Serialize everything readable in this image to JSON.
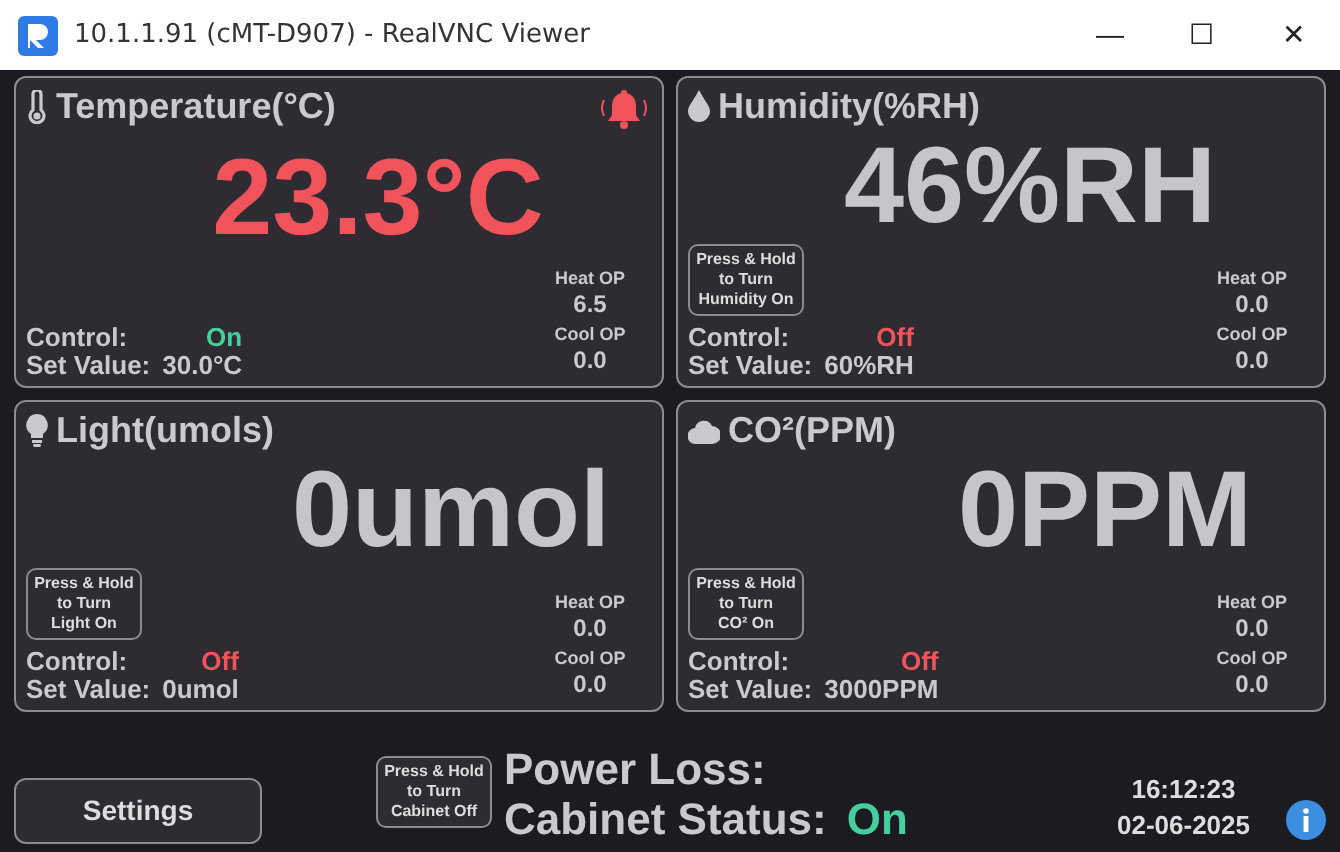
{
  "window": {
    "title": "10.1.1.91 (cMT-D907) - RealVNC Viewer",
    "controls": [
      "—",
      "☐",
      "✕"
    ]
  },
  "panels": [
    {
      "kind": "temperature",
      "title": "Temperature(°C)",
      "alarm": true,
      "reading": "23.3°C",
      "reading_alarm": true,
      "control_label": "Control:",
      "control_value": "On",
      "control_on": true,
      "set_label": "Set Value:",
      "set_value": "30.0°C",
      "heat_label": "Heat OP",
      "heat_value": "6.5",
      "cool_label": "Cool OP",
      "cool_value": "0.0"
    },
    {
      "kind": "humidity",
      "title": "Humidity(%RH)",
      "alarm": false,
      "reading": "46%RH",
      "reading_alarm": false,
      "button": [
        "Press & Hold",
        "to Turn",
        "Humidity On"
      ],
      "control_label": "Control:",
      "control_value": "Off",
      "control_on": false,
      "set_label": "Set Value:",
      "set_value": "60%RH",
      "heat_label": "Heat OP",
      "heat_value": "0.0",
      "cool_label": "Cool OP",
      "cool_value": "0.0"
    },
    {
      "kind": "light",
      "title": "Light(umols)",
      "alarm": false,
      "reading": "0umol",
      "reading_alarm": false,
      "button": [
        "Press & Hold",
        "to Turn",
        "Light On"
      ],
      "control_label": "Control:",
      "control_value": "Off",
      "control_on": false,
      "set_label": "Set Value:",
      "set_value": "0umol",
      "heat_label": "Heat OP",
      "heat_value": "0.0",
      "cool_label": "Cool OP",
      "cool_value": "0.0"
    },
    {
      "kind": "co2",
      "title": "CO²(PPM)",
      "alarm": false,
      "reading": "0PPM",
      "reading_alarm": false,
      "button": [
        "Press & Hold",
        "to Turn",
        "CO² On"
      ],
      "control_label": "Control:",
      "control_value": "Off",
      "control_on": false,
      "set_label": "Set Value:",
      "set_value": "3000PPM",
      "heat_label": "Heat OP",
      "heat_value": "0.0",
      "cool_label": "Cool OP",
      "cool_value": "0.0"
    }
  ],
  "footer": {
    "settings_button": "Settings",
    "cabinet_button": [
      "Press & Hold",
      "to Turn",
      "Cabinet Off"
    ],
    "power_loss_label": "Power Loss:",
    "cabinet_label": "Cabinet Status:",
    "cabinet_value": "On",
    "cabinet_on": true,
    "time": "16:12:23",
    "date": "02-06-2025"
  }
}
